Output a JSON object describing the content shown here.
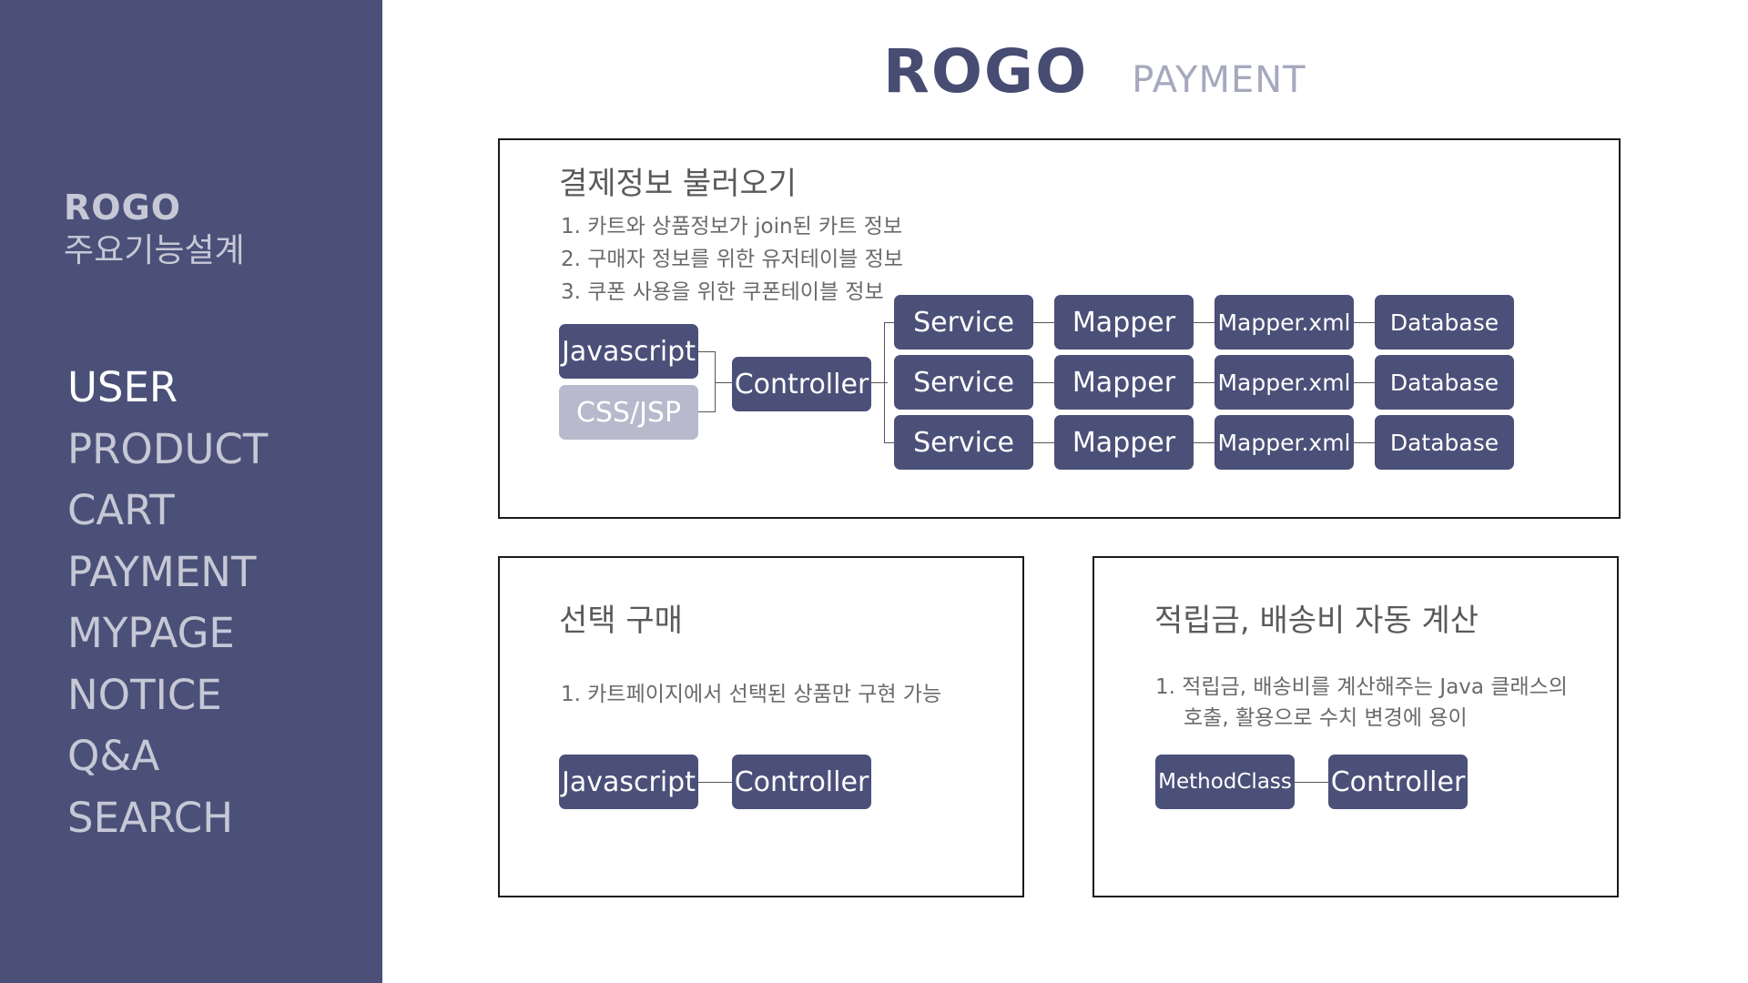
{
  "sidebar": {
    "brand_title": "ROGO",
    "brand_subtitle": "주요기능설계",
    "nav": [
      {
        "label": "USER",
        "active": true
      },
      {
        "label": "PRODUCT",
        "active": false
      },
      {
        "label": "CART",
        "active": false
      },
      {
        "label": "PAYMENT",
        "active": false
      },
      {
        "label": "MYPAGE",
        "active": false
      },
      {
        "label": "NOTICE",
        "active": false
      },
      {
        "label": "Q&A",
        "active": false
      },
      {
        "label": "SEARCH",
        "active": false
      }
    ]
  },
  "header": {
    "logo": "ROGO",
    "page": "PAYMENT"
  },
  "panel_payment_info": {
    "title": "결제정보 불러오기",
    "lines": [
      "1. 카트와 상품정보가 join된 카트 정보",
      "2. 구매자 정보를 위한 유저테이블 정보",
      "3. 쿠폰 사용을 위한 쿠폰테이블 정보"
    ],
    "diagram": {
      "front": [
        "Javascript",
        "CSS/JSP"
      ],
      "controller": "Controller",
      "rows": [
        [
          "Service",
          "Mapper",
          "Mapper.xml",
          "Database"
        ],
        [
          "Service",
          "Mapper",
          "Mapper.xml",
          "Database"
        ],
        [
          "Service",
          "Mapper",
          "Mapper.xml",
          "Database"
        ]
      ]
    }
  },
  "panel_select_purchase": {
    "title": "선택 구매",
    "line": "1. 카트페이지에서 선택된 상품만 구현 가능",
    "flow": [
      "Javascript",
      "Controller"
    ]
  },
  "panel_points": {
    "title": "적립금, 배송비 자동 계산",
    "lines": [
      "1. 적립금, 배송비를 계산해주는 Java 클래스의",
      "호출, 활용으로 수치 변경에 용이"
    ],
    "flow": [
      "MethodClass",
      "Controller"
    ]
  },
  "colors": {
    "sidebar_bg": "#4a5078",
    "box_bg": "#4a5078",
    "box_light_bg": "#b8b9cc",
    "nav_active": "#ffffff",
    "nav_inactive": "#c6c8d6"
  }
}
